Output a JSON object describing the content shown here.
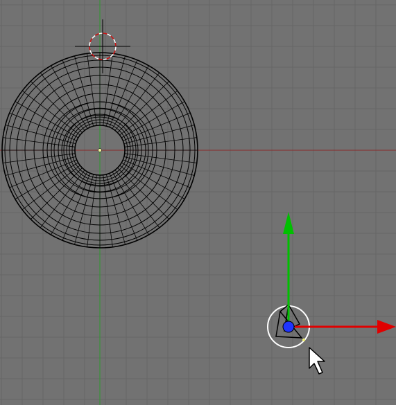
{
  "viewport": {
    "colors": {
      "background": "#727272",
      "grid": "#666666",
      "x_axis": "#8a2a2a",
      "y_axis": "#2e9a2e",
      "wire": "#000000",
      "cursor_ring": "#d01010",
      "gizmo_x": "#e00000",
      "gizmo_y": "#00c000",
      "gizmo_center": "#1f35ff",
      "selection_circle": "#ffffff"
    },
    "objects": [
      {
        "name": "torus-mesh",
        "selected": false
      },
      {
        "name": "camera-object",
        "selected": true
      }
    ],
    "icons": [
      "3d-cursor-icon",
      "translate-x-arrow-icon",
      "translate-y-arrow-icon",
      "mouse-pointer-icon"
    ]
  }
}
